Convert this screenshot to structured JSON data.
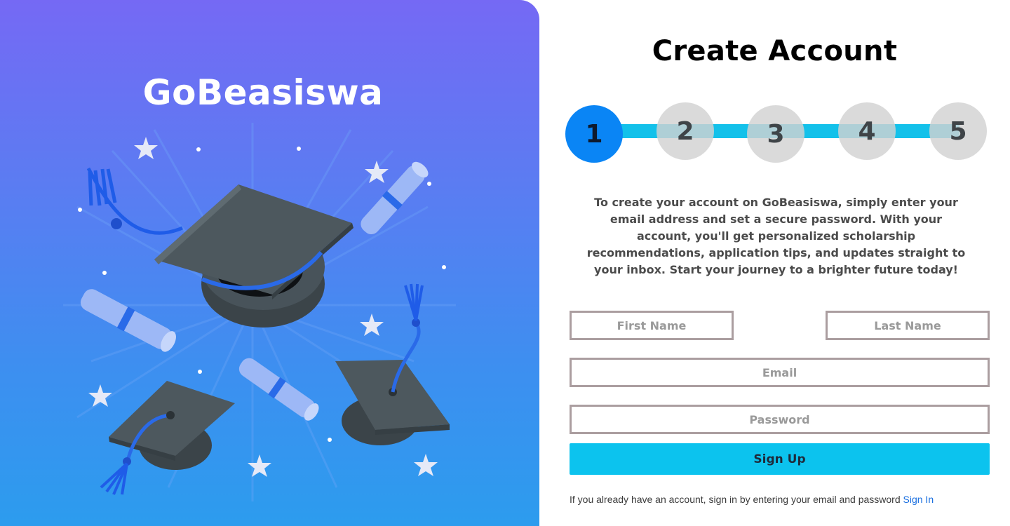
{
  "brand": {
    "name": "GoBeasiswa"
  },
  "illustration": {
    "icon": "graduation-caps-and-diplomas-illustration"
  },
  "form": {
    "title": "Create Account",
    "steps": [
      {
        "label": "1",
        "active": true
      },
      {
        "label": "2",
        "active": false
      },
      {
        "label": "3",
        "active": false
      },
      {
        "label": "4",
        "active": false
      },
      {
        "label": "5",
        "active": false
      }
    ],
    "intro": "To create your account on GoBeasiswa, simply enter your email address and set a secure password. With your account, you'll get personalized scholarship recommendations, application tips, and updates straight to your inbox. Start your journey to a brighter future today!",
    "first_name": {
      "placeholder": "First Name",
      "value": ""
    },
    "last_name": {
      "placeholder": "Last Name",
      "value": ""
    },
    "email": {
      "placeholder": "Email",
      "value": ""
    },
    "password": {
      "placeholder": "Password",
      "value": ""
    },
    "signup_label": "Sign Up",
    "footer_text": "If you already have an account, sign in by entering your email and password",
    "signin_link": "Sign In"
  },
  "colors": {
    "gradient_top": "#7569f4",
    "gradient_bottom": "#2c9cee",
    "accent": "#0cc3ee",
    "active_step": "#0a85f5",
    "link": "#1a6fe0"
  }
}
